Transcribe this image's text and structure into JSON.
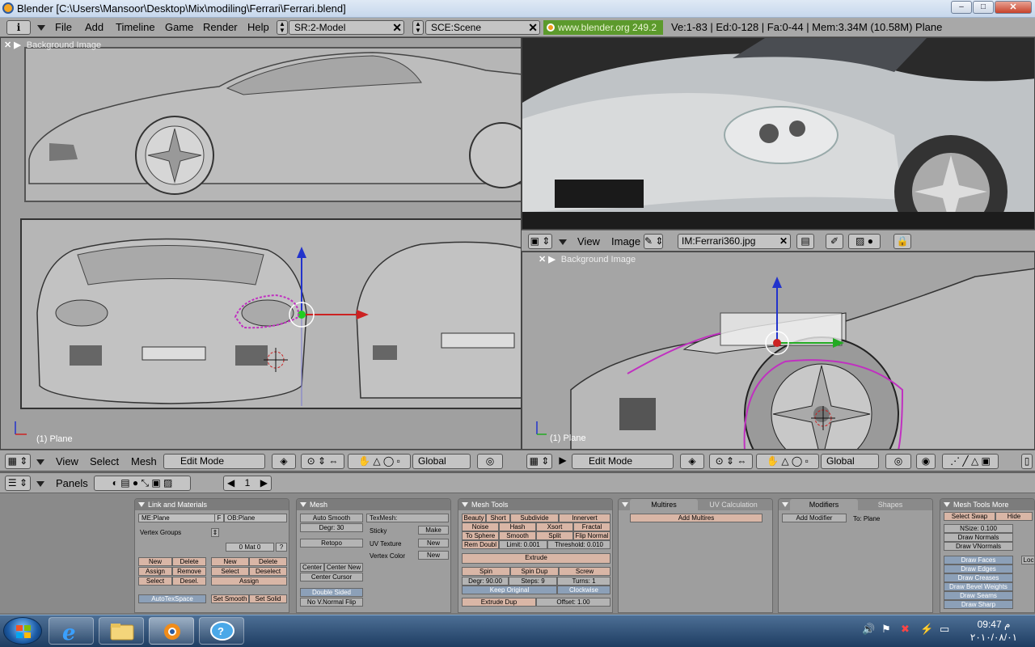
{
  "window": {
    "title": "Blender [C:\\Users\\Mansoor\\Desktop\\Mix\\modiling\\Ferrari\\Ferrari.blend]",
    "minimize": "–",
    "maximize": "□",
    "close": "✕"
  },
  "topbar": {
    "info_icon": "i",
    "menus": [
      "File",
      "Add",
      "Timeline",
      "Game",
      "Render",
      "Help"
    ],
    "screen_field": "SR:2-Model",
    "scene_field": "SCE:Scene",
    "url": "www.blender.org 249.2",
    "stats": "Ve:1-83 | Ed:0-128 | Fa:0-44 | Mem:3.34M (10.58M) Plane"
  },
  "viewport_left": {
    "bg_label": "Background Image",
    "plane_label": "(1) Plane",
    "header": {
      "menus": [
        "View",
        "Select",
        "Mesh"
      ],
      "mode": "Edit Mode",
      "orientation": "Global"
    }
  },
  "image_editor": {
    "header": {
      "menus": [
        "View",
        "Image"
      ],
      "image_name": "IM:Ferrari360.jpg"
    }
  },
  "viewport_right": {
    "bg_label": "Background Image",
    "plane_label": "(1) Plane",
    "header": {
      "mode": "Edit Mode",
      "orientation": "Global"
    }
  },
  "buttons_header": {
    "panels_label": "Panels",
    "frame": "1"
  },
  "panels": {
    "link_materials": {
      "title": "Link and Materials",
      "me_field": "ME:Plane",
      "f_btn": "F",
      "ob_field": "OB:Plane",
      "vertex_groups": "Vertex Groups",
      "mat_field": "0 Mat 0",
      "q_btn": "?",
      "new1": "New",
      "delete1": "Delete",
      "assign1": "Assign",
      "remove1": "Remove",
      "select1": "Select",
      "desel1": "Desel.",
      "new2": "New",
      "delete2": "Delete",
      "select2": "Select",
      "deselect2": "Deselect",
      "assign2": "Assign",
      "autotex": "AutoTexSpace",
      "set_smooth": "Set Smooth",
      "set_solid": "Set Solid"
    },
    "mesh": {
      "title": "Mesh",
      "auto_smooth": "Auto Smooth",
      "degr": "Degr: 30",
      "retopo": "Retopo",
      "center": "Center",
      "center_new": "Center New",
      "center_cursor": "Center Cursor",
      "double_sided": "Double Sided",
      "no_vnormal_flip": "No V.Normal Flip",
      "texmesh": "TexMesh:",
      "sticky": "Sticky",
      "make": "Make",
      "uv_texture": "UV Texture",
      "new_uv": "New",
      "vertex_color": "Vertex Color",
      "new_vc": "New"
    },
    "mesh_tools": {
      "title": "Mesh Tools",
      "beauty": "Beauty",
      "short": "Short",
      "subdivide": "Subdivide",
      "innervert": "Innervert",
      "noise": "Noise",
      "hash": "Hash",
      "xsort": "Xsort",
      "fractal": "Fractal",
      "to_sphere": "To Sphere",
      "smooth": "Smooth",
      "split": "Split",
      "flip_normal": "Flip Normal",
      "rem_doubl": "Rem Doubl",
      "limit": "Limit: 0.001",
      "threshold": "Threshold: 0.010",
      "extrude": "Extrude",
      "spin": "Spin",
      "spin_dup": "Spin Dup",
      "screw": "Screw",
      "degr": "Degr: 90.00",
      "steps": "Steps: 9",
      "turns": "Turns: 1",
      "keep_original": "Keep Original",
      "clockwise": "Clockwise",
      "extrude_dup": "Extrude Dup",
      "offset": "Offset: 1.00"
    },
    "multires": {
      "tab1": "Multires",
      "tab2": "UV Calculation",
      "add_multires": "Add Multires"
    },
    "modifiers": {
      "tab1": "Modifiers",
      "tab2": "Shapes",
      "add_modifier": "Add Modifier",
      "to_plane": "To: Plane"
    },
    "mesh_tools_more": {
      "title": "Mesh Tools More",
      "select_swap": "Select Swap",
      "hide": "Hide",
      "nsize": "NSize: 0.100",
      "draw_normals": "Draw Normals",
      "draw_vnormals": "Draw VNormals",
      "draw_faces": "Draw Faces",
      "draw_edges": "Draw Edges",
      "draw_creases": "Draw Creases",
      "draw_bevel_weights": "Draw Bevel Weights",
      "draw_seams": "Draw Seams",
      "draw_sharp": "Draw Sharp",
      "loc": "Loc"
    }
  },
  "taskbar": {
    "time": "09:47 م",
    "date": "٢٠١٠/٠٨/٠١"
  },
  "colors": {
    "blender_header": "#a8a8a8",
    "viewport_bg": "#9a9a9a",
    "panel_bg": "#9e9e9e",
    "version_badge": "#5c9a2c",
    "pink_button": "#d9b6a6",
    "blue_button": "#8ca0b8"
  }
}
